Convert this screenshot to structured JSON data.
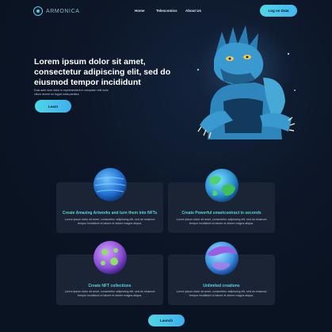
{
  "brand": {
    "name": "ARMONICA"
  },
  "nav": {
    "links": [
      "Home",
      "Telescomics",
      "About Us"
    ],
    "login_label": "Log on Data"
  },
  "hero": {
    "title": "Lorem ipsum dolor sit amet, consectetur adipiscing elit, sed do eiusmod tempor incididunt",
    "subtitle": "Duis aute irure dolor in reprehenderit in voluptate velit esse cillum dolore eu fugiat nulla pariatur.",
    "button_label": "Learn"
  },
  "features": [
    {
      "title": "Create Amazing Artworks and turn them into NFTs",
      "desc": "Lorem ipsum dolor sit amet, consectetur adipiscing elit, sed do eiusmod tempor incididunt ut labore et dolore magna aliqua.",
      "icon": "blue-planet-icon"
    },
    {
      "title": "Create Powerful smartcontract in seconds",
      "desc": "Lorem ipsum dolor sit amet, consectetur adipiscing elit, sed do eiusmod tempor incididunt ut labore et dolore magna aliqua.",
      "icon": "green-planet-icon"
    },
    {
      "title": "Create NFT collections",
      "desc": "Lorem ipsum dolor sit amet, consectetur adipiscing elit, sed do eiusmod tempor incididunt ut labore et dolore magna aliqua.",
      "icon": "purple-planet-icon"
    },
    {
      "title": "Unlimited creations",
      "desc": "Lorem ipsum dolor sit amet, consectetur adipiscing elit, sed do eiusmod tempor incididunt ut labore et dolore magna aliqua.",
      "icon": "ocean-planet-icon"
    }
  ],
  "bottom": {
    "button_label": "Launch"
  },
  "colors": {
    "background": "#0b1424",
    "accent": "#4fd6e6",
    "card": "#1a2435"
  }
}
